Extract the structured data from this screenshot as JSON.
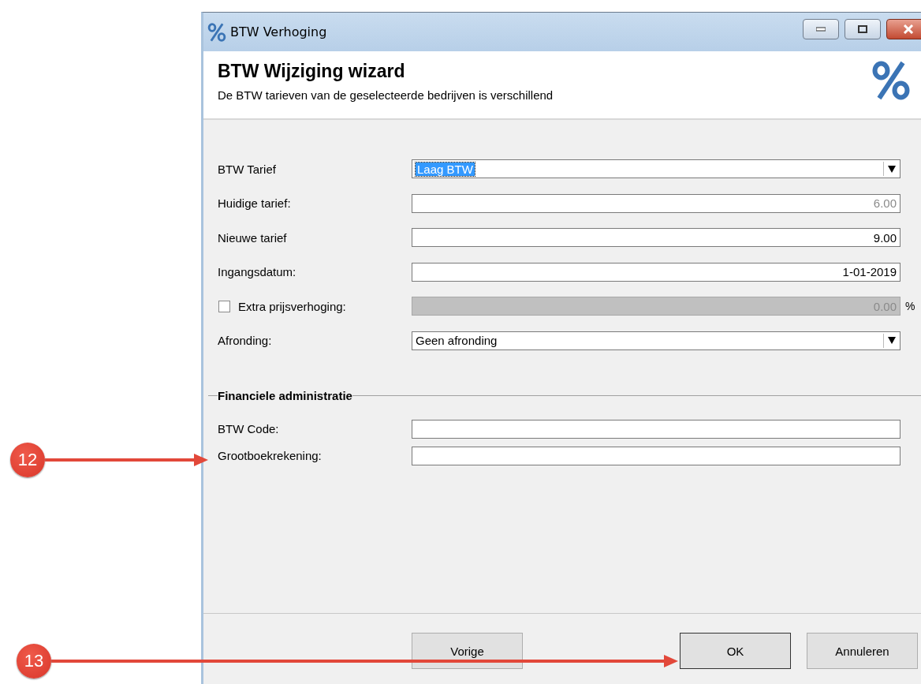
{
  "window": {
    "title": "BTW Verhoging"
  },
  "header": {
    "title": "BTW Wijziging wizard",
    "subtitle": "De BTW tarieven van de geselecteerde bedrijven is verschillend"
  },
  "fields": [
    {
      "kind": "dropdown",
      "label": "BTW Tarief",
      "value": "Laag BTW",
      "highlighted": true
    },
    {
      "kind": "text",
      "label": "Huidige tarief:",
      "value": "6.00",
      "readonly": true
    },
    {
      "kind": "text",
      "label": "Nieuwe tarief",
      "value": "9.00",
      "readonly": false
    },
    {
      "kind": "text",
      "label": "Ingangsdatum:",
      "value": "1-01-2019",
      "readonly": false
    },
    {
      "kind": "checkbox",
      "label": "Extra prijsverhoging:",
      "checked": false,
      "value": "0.00",
      "disabled": true,
      "unit": "%"
    },
    {
      "kind": "dropdown",
      "label": "Afronding:",
      "value": "Geen afronding",
      "highlighted": false
    }
  ],
  "section": {
    "title": "Financiele administratie",
    "fields": [
      {
        "label": "BTW Code:"
      },
      {
        "label": "Grootboekrekening:"
      }
    ]
  },
  "buttons": [
    {
      "label": "Vorige"
    },
    {
      "label": "OK"
    },
    {
      "label": "Annuleren"
    }
  ],
  "callouts": [
    {
      "number": "12"
    },
    {
      "number": "13"
    }
  ]
}
